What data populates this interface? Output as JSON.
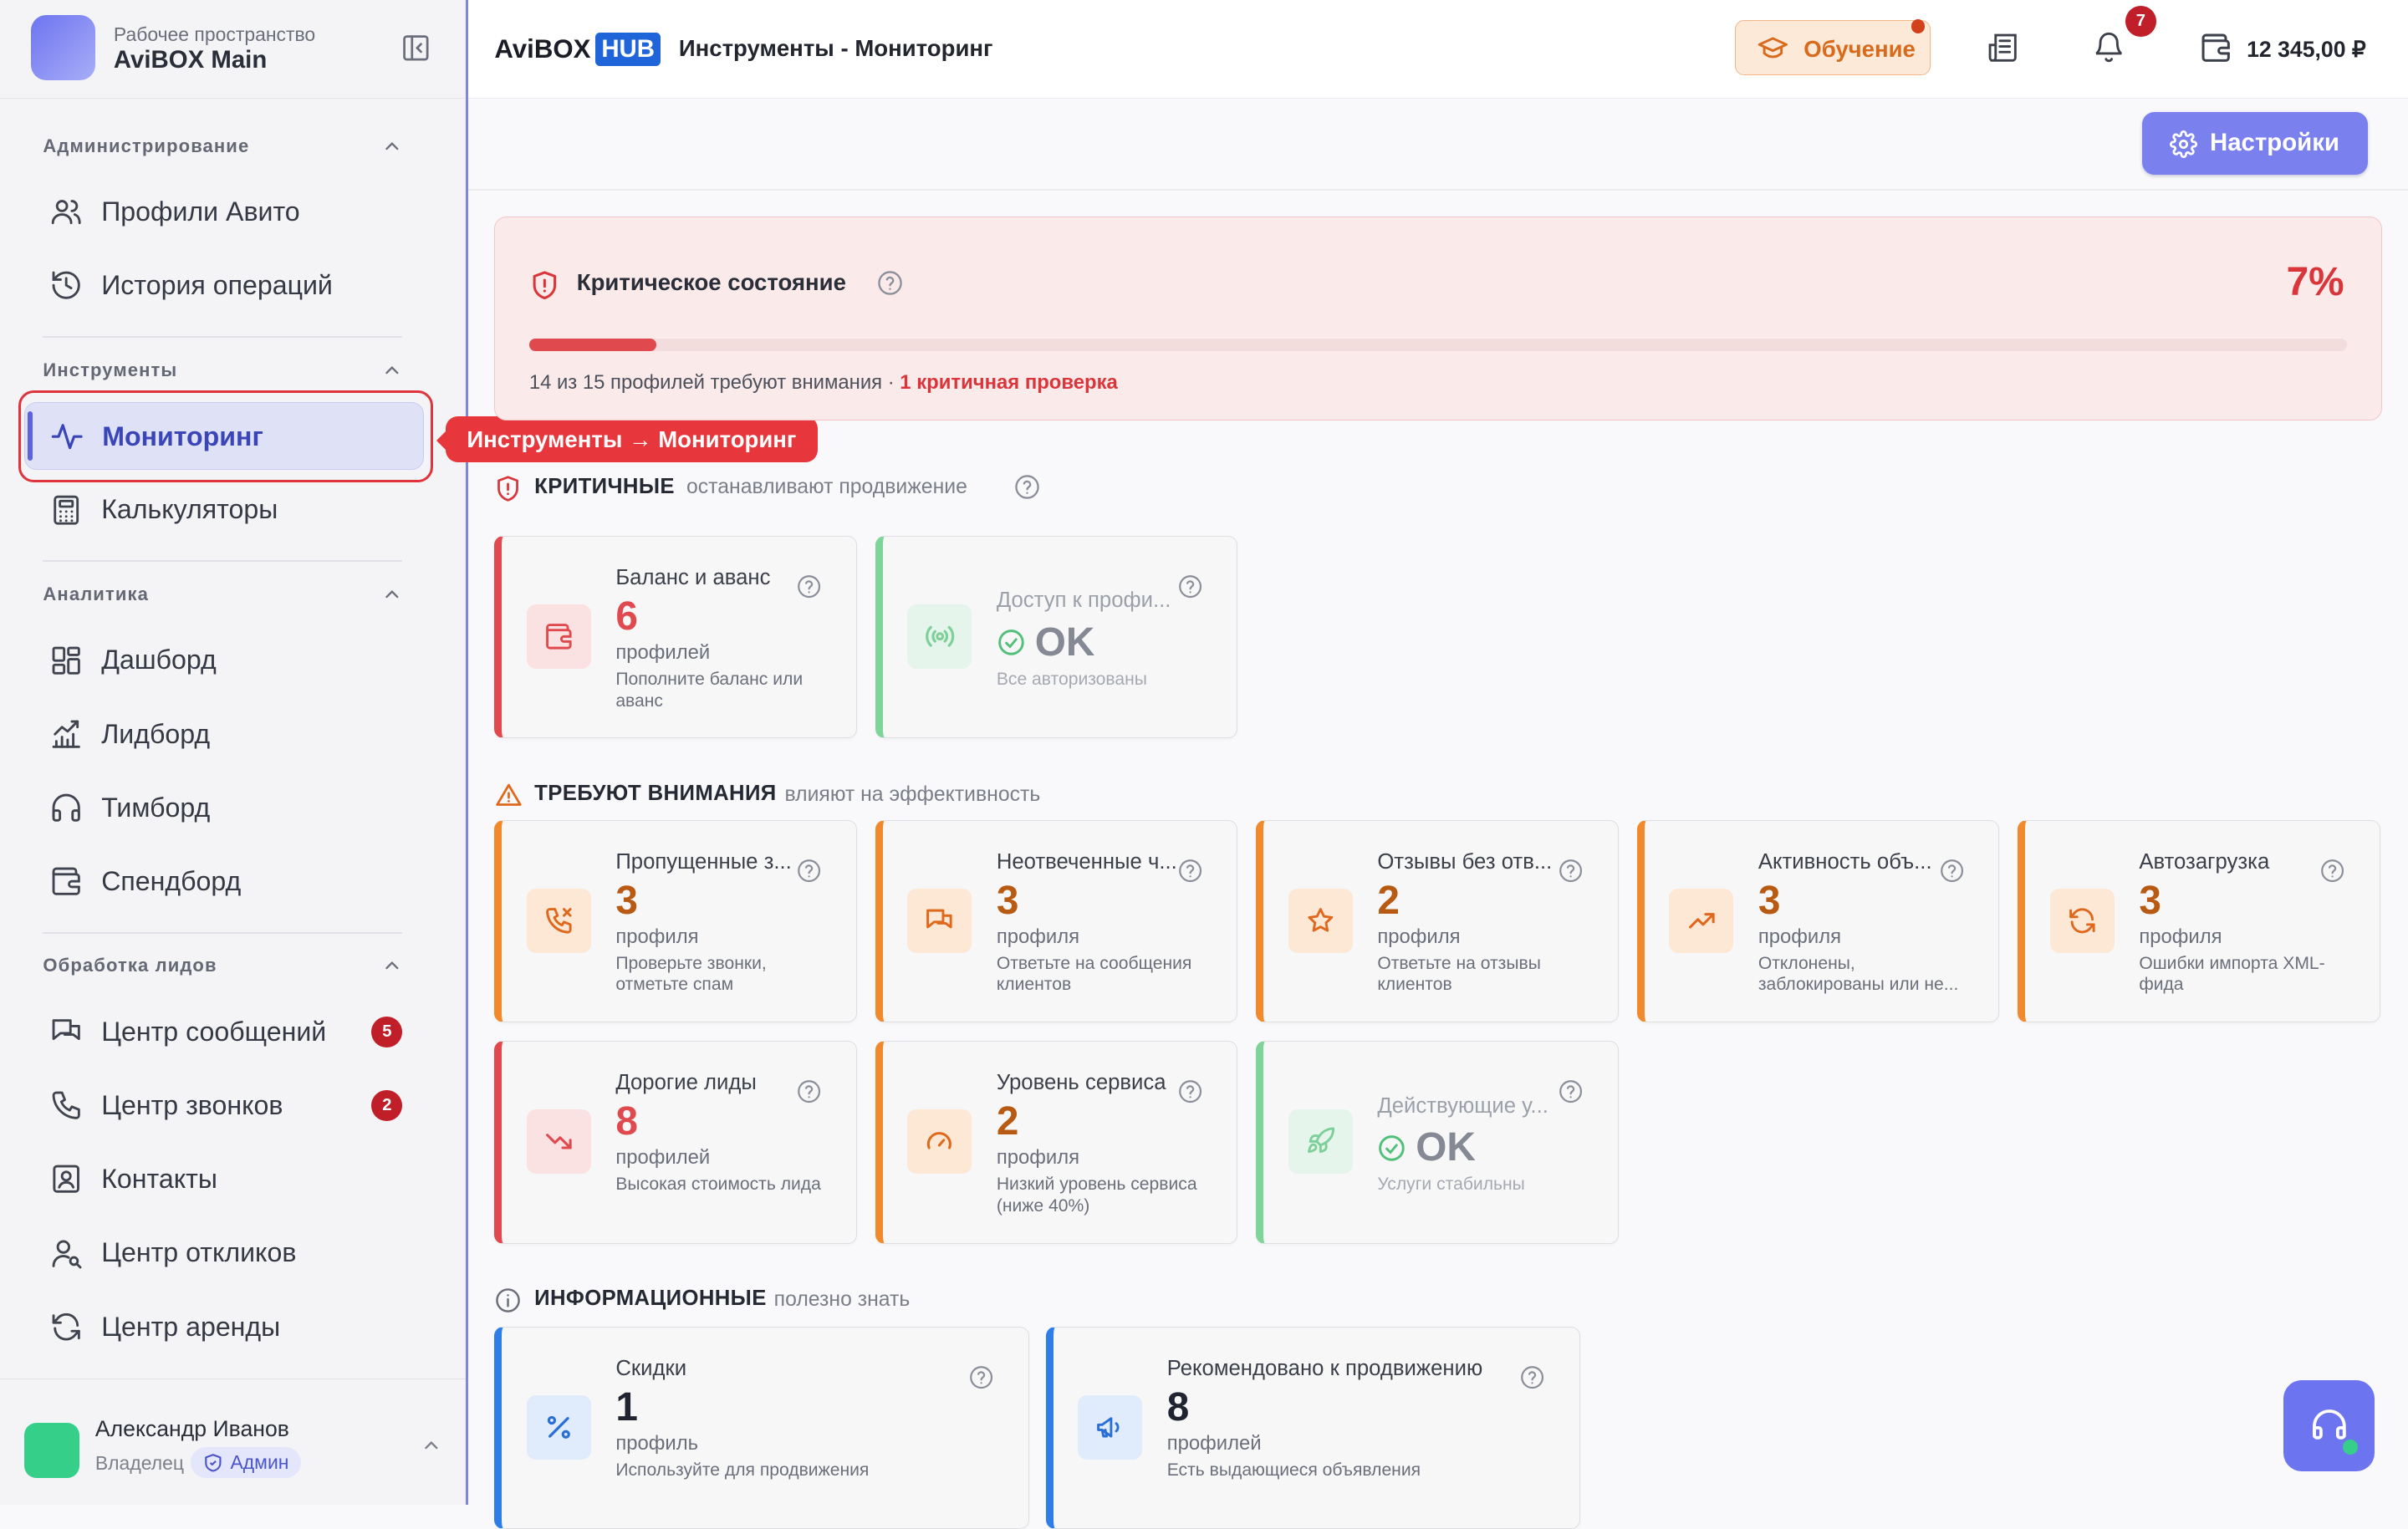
{
  "workspace": {
    "caption": "Рабочее пространство",
    "name": "AviBOX Main"
  },
  "sidebar": {
    "sections": [
      {
        "title": "Администрирование",
        "items": [
          {
            "label": "Профили Авито",
            "icon": "users-icon"
          },
          {
            "label": "История операций",
            "icon": "history-icon"
          }
        ]
      },
      {
        "title": "Инструменты",
        "items": [
          {
            "label": "Мониторинг",
            "icon": "activity-icon",
            "active": true
          },
          {
            "label": "Калькуляторы",
            "icon": "calculator-icon"
          }
        ]
      },
      {
        "title": "Аналитика",
        "items": [
          {
            "label": "Дашборд",
            "icon": "dashboard-icon"
          },
          {
            "label": "Лидборд",
            "icon": "chart-icon"
          },
          {
            "label": "Тимборд",
            "icon": "headphones-icon"
          },
          {
            "label": "Спендборд",
            "icon": "wallet-icon"
          }
        ]
      },
      {
        "title": "Обработка лидов",
        "items": [
          {
            "label": "Центр сообщений",
            "icon": "messages-icon",
            "badge": "5"
          },
          {
            "label": "Центр звонков",
            "icon": "phone-icon",
            "badge": "2"
          },
          {
            "label": "Контакты",
            "icon": "contacts-icon"
          },
          {
            "label": "Центр откликов",
            "icon": "user-search-icon"
          },
          {
            "label": "Центр аренды",
            "icon": "refresh-icon"
          }
        ]
      }
    ]
  },
  "tooltip": "Инструменты → Мониторинг",
  "user": {
    "name": "Александр Иванов",
    "role": "Владелец",
    "badge": "Админ"
  },
  "header": {
    "brand_main": "AviBOX",
    "brand_box": "HUB",
    "title": "Инструменты - Мониторинг",
    "learn_label": "Обучение",
    "notifications_count": "7",
    "balance": "12 345,00 ₽"
  },
  "settings_label": "Настройки",
  "critical_panel": {
    "title": "Критическое состояние",
    "percent_label": "7%",
    "progress_fraction": 0.07,
    "summary": "14 из 15 профилей требуют внимания · ",
    "summary_highlight": "1 критичная проверка"
  },
  "categories": {
    "critical": {
      "title": "КРИТИЧНЫЕ",
      "subtitle": "останавливают продвижение"
    },
    "attention": {
      "title": "ТРЕБУЮТ ВНИМАНИЯ",
      "subtitle": "влияют на эффективность"
    },
    "info": {
      "title": "ИНФОРМАЦИОННЫЕ",
      "subtitle": "полезно знать"
    }
  },
  "cards": {
    "balance": {
      "title": "Баланс и аванс",
      "value": "6",
      "unit": "профилей",
      "desc": "Пополните баланс или аванс",
      "icon": "wallet-icon"
    },
    "access": {
      "title": "Доступ к профи...",
      "value": "OK",
      "desc": "Все авторизованы",
      "icon": "signal-icon"
    },
    "missed_calls": {
      "title": "Пропущенные з...",
      "value": "3",
      "unit": "профиля",
      "desc": "Проверьте звонки, отметьте спам",
      "icon": "phone-missed-icon"
    },
    "unanswered": {
      "title": "Неотвеченные ч...",
      "value": "3",
      "unit": "профиля",
      "desc": "Ответьте на сообщения клиентов",
      "icon": "messages-icon"
    },
    "reviews": {
      "title": "Отзывы без отв...",
      "value": "2",
      "unit": "профиля",
      "desc": "Ответьте на отзывы клиентов",
      "icon": "star-icon"
    },
    "activity": {
      "title": "Активность объ...",
      "value": "3",
      "unit": "профиля",
      "desc": "Отклонены, заблокированы или не...",
      "icon": "trending-up-icon"
    },
    "autoload": {
      "title": "Автозагрузка",
      "value": "3",
      "unit": "профиля",
      "desc": "Ошибки импорта XML-фида",
      "icon": "refresh-icon"
    },
    "expensive": {
      "title": "Дорогие лиды",
      "value": "8",
      "unit": "профилей",
      "desc": "Высокая стоимость лида",
      "icon": "trending-down-icon"
    },
    "service": {
      "title": "Уровень сервиса",
      "value": "2",
      "unit": "профиля",
      "desc": "Низкий уровень сервиса (ниже 40%)",
      "icon": "gauge-icon"
    },
    "services": {
      "title": "Действующие у...",
      "value": "OK",
      "desc": "Услуги стабильны",
      "icon": "rocket-icon"
    },
    "discounts": {
      "title": "Скидки",
      "value": "1",
      "unit": "профиль",
      "desc": "Используйте для продвижения",
      "icon": "percent-icon"
    },
    "recommended": {
      "title": "Рекомендовано к продвижению",
      "value": "8",
      "unit": "профилей",
      "desc": "Есть выдающиеся объявления",
      "icon": "megaphone-icon"
    }
  }
}
